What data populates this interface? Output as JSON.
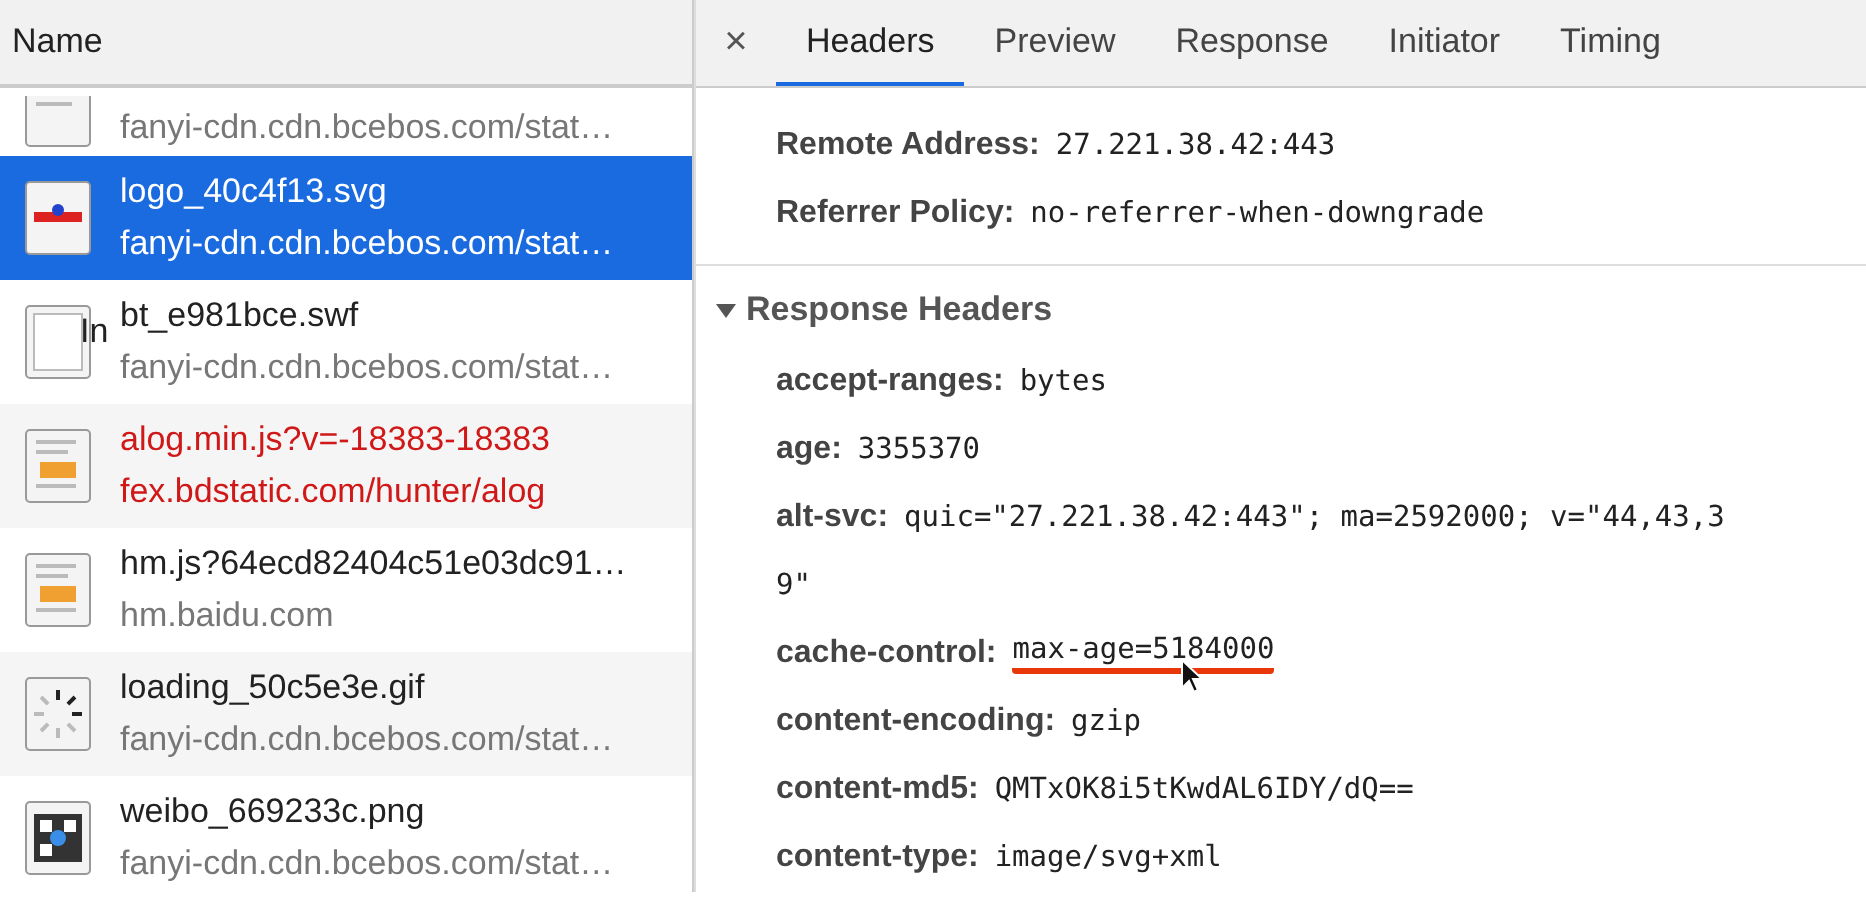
{
  "requests": {
    "column_header": "Name",
    "rows": [
      {
        "kind": "css",
        "name": "",
        "domain": "fanyi-cdn.cdn.bcebos.com/stat…",
        "selected": false,
        "error": false
      },
      {
        "kind": "logo",
        "name": "logo_40c4f13.svg",
        "domain": "fanyi-cdn.cdn.bcebos.com/stat…",
        "selected": true,
        "error": false
      },
      {
        "kind": "blank",
        "overlay": "In",
        "name": "bt_e981bce.swf",
        "domain": "fanyi-cdn.cdn.bcebos.com/stat…",
        "selected": false,
        "error": false
      },
      {
        "kind": "js",
        "name": "alog.min.js?v=-18383-18383",
        "domain": "fex.bdstatic.com/hunter/alog",
        "selected": false,
        "error": true
      },
      {
        "kind": "js",
        "name": "hm.js?64ecd82404c51e03dc91…",
        "domain": "hm.baidu.com",
        "selected": false,
        "error": false
      },
      {
        "kind": "spinner",
        "name": "loading_50c5e3e.gif",
        "domain": "fanyi-cdn.cdn.bcebos.com/stat…",
        "selected": false,
        "error": false
      },
      {
        "kind": "qr",
        "name": "weibo_669233c.png",
        "domain": "fanyi-cdn.cdn.bcebos.com/stat…",
        "selected": false,
        "error": false
      }
    ]
  },
  "details": {
    "close": "×",
    "tabs": [
      {
        "label": "Headers",
        "selected": true
      },
      {
        "label": "Preview",
        "selected": false
      },
      {
        "label": "Response",
        "selected": false
      },
      {
        "label": "Initiator",
        "selected": false
      },
      {
        "label": "Timing",
        "selected": false
      }
    ],
    "general": [
      {
        "name": "Remote Address:",
        "value": "27.221.38.42:443"
      },
      {
        "name": "Referrer Policy:",
        "value": "no-referrer-when-downgrade"
      }
    ],
    "response_headers": {
      "title": "Response Headers",
      "expanded": true,
      "items": [
        {
          "name": "accept-ranges:",
          "value": "bytes",
          "underlined": false
        },
        {
          "name": "age:",
          "value": "3355370",
          "underlined": false
        },
        {
          "name": "alt-svc:",
          "value": "quic=\"27.221.38.42:443\"; ma=2592000; v=\"44,43,3",
          "continuation": "9\"",
          "underlined": false
        },
        {
          "name": "cache-control:",
          "value": "max-age=5184000",
          "underlined": true,
          "cursor": true
        },
        {
          "name": "content-encoding:",
          "value": "gzip",
          "underlined": false
        },
        {
          "name": "content-md5:",
          "value": "QMTxOK8i5tKwdAL6IDY/dQ==",
          "underlined": false
        },
        {
          "name": "content-type:",
          "value": "image/svg+xml",
          "underlined": false
        }
      ]
    }
  }
}
